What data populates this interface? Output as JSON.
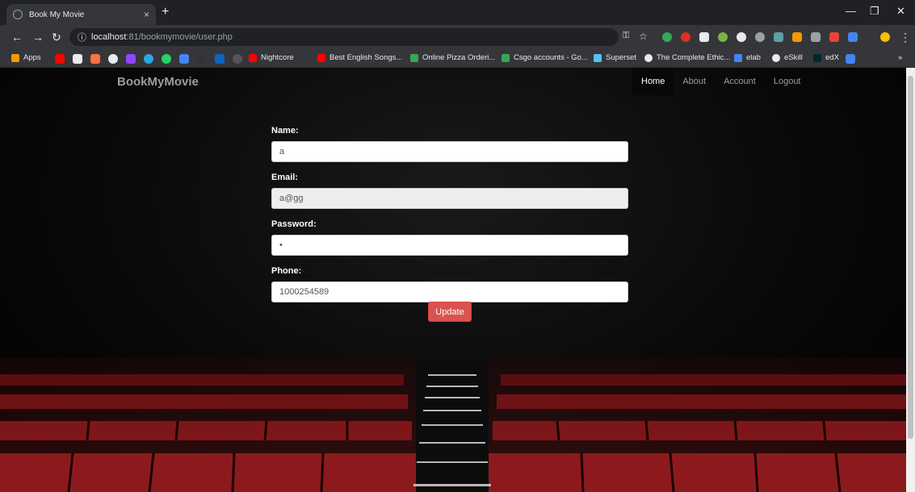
{
  "browser": {
    "tab_title": "Book My Movie",
    "tab_close": "×",
    "new_tab": "+",
    "url_host": "localhost",
    "url_rest": ":81/bookmymovie/user.php",
    "bookmarks": [
      "Apps",
      "Nightcore",
      "Best English Songs...",
      "Online Pizza Orderi...",
      "Csgo accounts - Go...",
      "Superset",
      "The Complete Ethic...",
      "elab",
      "eSkill",
      "edX"
    ],
    "overflow": "»"
  },
  "navbar": {
    "brand": "BookMyMovie",
    "links": [
      "Home",
      "About",
      "Account",
      "Logout"
    ],
    "active_index": 0
  },
  "form": {
    "name_label": "Name:",
    "name_value": "a",
    "email_label": "Email:",
    "email_value": "a@gg",
    "password_label": "Password:",
    "password_value": "a",
    "phone_label": "Phone:",
    "phone_value": "1000254589",
    "submit_label": "Update"
  },
  "colors": {
    "accent_button": "#d9534f",
    "seat_red": "#7a1518"
  }
}
